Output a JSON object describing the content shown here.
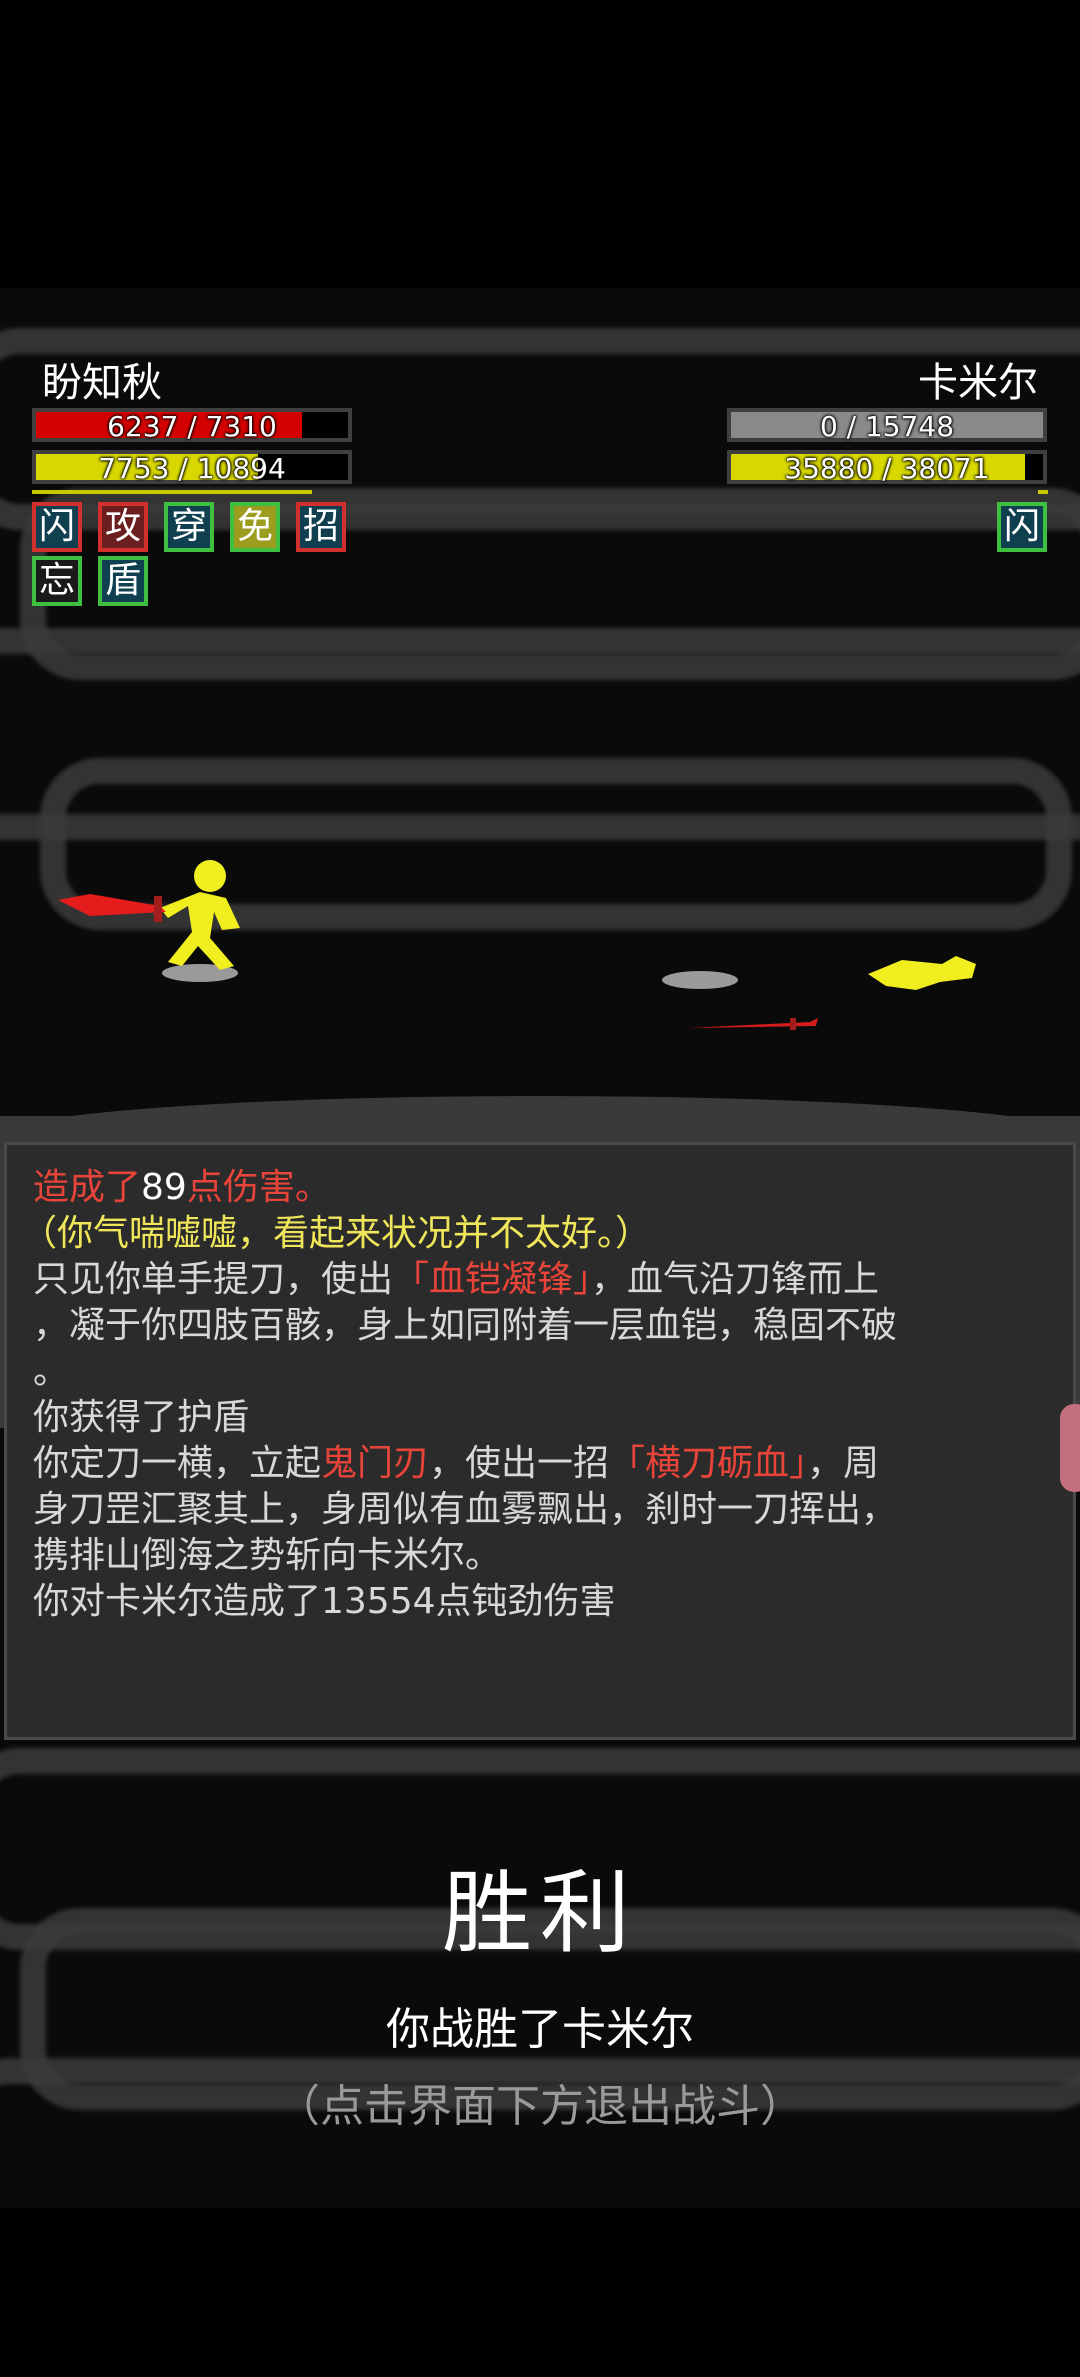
{
  "player": {
    "name": "盼知秋",
    "hp_text": "6237 / 7310",
    "hp_fraction": 0.853,
    "mp_text": "7753 / 10894",
    "mp_fraction": 0.712,
    "tags": [
      {
        "char": "闪",
        "border": "#d32f2f",
        "bg": "#104050"
      },
      {
        "char": "攻",
        "border": "#d32f2f",
        "bg": "#6b1f1f"
      },
      {
        "char": "穿",
        "border": "#3fbf3f",
        "bg": "#104050"
      },
      {
        "char": "免",
        "border": "#3fbf3f",
        "bg": "#9c9c1f"
      },
      {
        "char": "招",
        "border": "#d32f2f",
        "bg": "#104050"
      },
      {
        "char": "忘",
        "border": "#3fbf3f",
        "bg": "#1a1a1a"
      },
      {
        "char": "盾",
        "border": "#3fbf3f",
        "bg": "#104050"
      }
    ]
  },
  "enemy": {
    "name": "卡米尔",
    "hp_text": "0 / 15748",
    "hp_fraction": 0.0,
    "mp_text": "35880 / 38071",
    "mp_fraction": 0.942,
    "tags": [
      {
        "char": "闪",
        "border": "#3fbf3f",
        "bg": "#104050"
      }
    ]
  },
  "log": {
    "line1_a": "造成了",
    "line1_b": "89",
    "line1_c": "点伤害。",
    "line2": "（你气喘嘘嘘，看起来状况并不太好。）",
    "line3_a": "只见你单手提刀，使出",
    "line3_b": "「血铠凝锋」",
    "line3_c": "，血气沿刀锋而上",
    "line4": "，凝于你四肢百骸，身上如同附着一层血铠，稳固不破",
    "line5": "。",
    "line6": "你获得了护盾",
    "line7_a": "你定刀一横，立起",
    "line7_b": "鬼门刃",
    "line7_c": "，使出一招",
    "line7_d": "「横刀砺血」",
    "line7_e": "，周",
    "line8": "身刀罡汇聚其上，身周似有血雾飘出，刹时一刀挥出，",
    "line9": "携排山倒海之势斩向卡米尔。",
    "line10": "你对卡米尔造成了13554点钝劲伤害"
  },
  "victory": {
    "title": "胜利",
    "subtitle": "你战胜了卡米尔",
    "hint": "（点击界面下方退出战斗）"
  },
  "colors": {
    "hp": "#d40000",
    "mp": "#d8d800",
    "hp_empty": "#8a8a8a"
  }
}
